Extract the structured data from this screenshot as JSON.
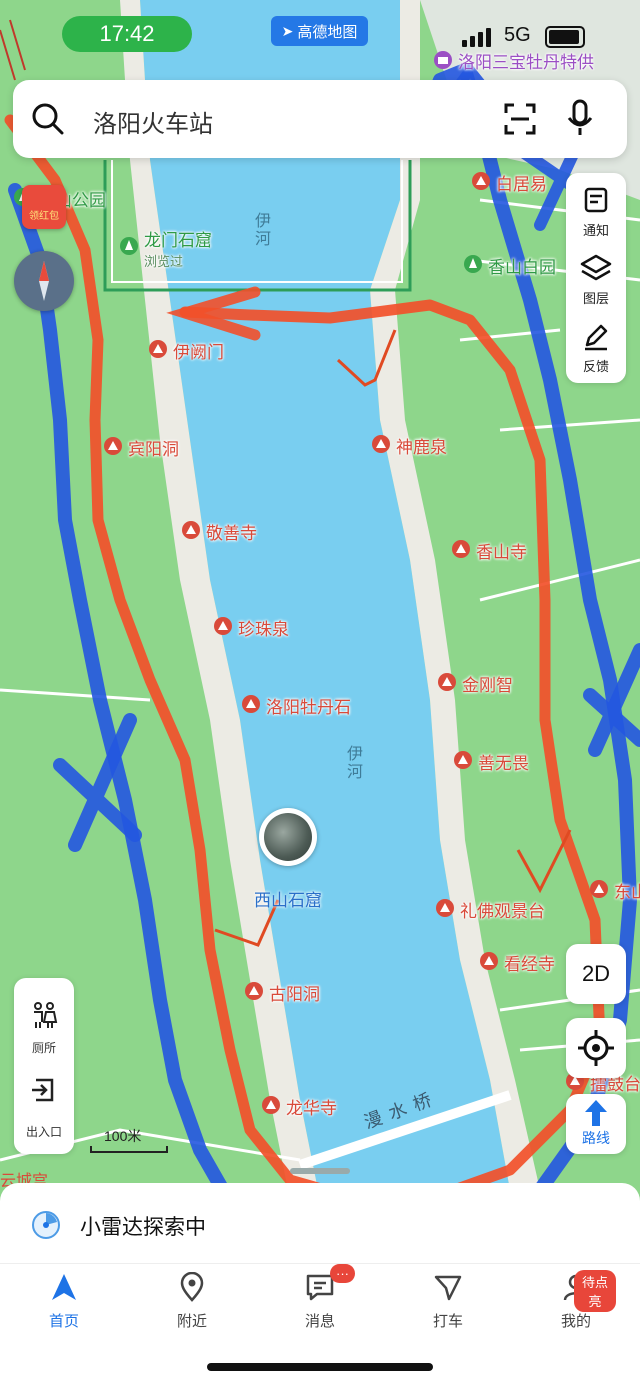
{
  "status_bar": {
    "time": "17:42",
    "brand": "高德地图",
    "network": "5G"
  },
  "search": {
    "text": "洛阳火车站"
  },
  "side_panel": {
    "notify": "通知",
    "layers": "图层",
    "feedback": "反馈"
  },
  "red_packet": "领红包",
  "map": {
    "river_labels": [
      "伊河",
      "伊河"
    ],
    "green_pois": [
      {
        "name": "西山公园"
      },
      {
        "name": "龙门石窟",
        "sub": "浏览过"
      },
      {
        "name": "香山白园"
      }
    ],
    "pois": [
      {
        "name": "洛阳三宝牡丹特供"
      },
      {
        "name": "白居易"
      },
      {
        "name": "伊阙门"
      },
      {
        "name": "宾阳洞"
      },
      {
        "name": "神鹿泉"
      },
      {
        "name": "敬善寺"
      },
      {
        "name": "香山寺"
      },
      {
        "name": "珍珠泉"
      },
      {
        "name": "金刚智"
      },
      {
        "name": "洛阳牡丹石"
      },
      {
        "name": "善无畏"
      },
      {
        "name": "礼佛观景台"
      },
      {
        "name": "东山"
      },
      {
        "name": "看经寺"
      },
      {
        "name": "古阳洞"
      },
      {
        "name": "龙华寺"
      },
      {
        "name": "擂鼓台"
      }
    ],
    "current_spot": "西山石窟",
    "bridge": "漫水桥",
    "edge_label": "云城宫",
    "scale": "100米"
  },
  "left_panel": {
    "toilet": "厕所",
    "entrance": "出入口"
  },
  "buttons": {
    "view_mode": "2D",
    "route": "路线"
  },
  "radar": {
    "text": "小雷达探索中"
  },
  "tabs": [
    {
      "label": "首页"
    },
    {
      "label": "附近"
    },
    {
      "label": "消息"
    },
    {
      "label": "打车"
    },
    {
      "label": "我的"
    }
  ],
  "badges": {
    "messages": "···",
    "profile": "待点亮"
  },
  "colors": {
    "water": "#79cef0",
    "land": "#8ed68b",
    "red_route": "#f2502a",
    "blue_route": "#2456e0",
    "accent": "#1e73e6"
  }
}
